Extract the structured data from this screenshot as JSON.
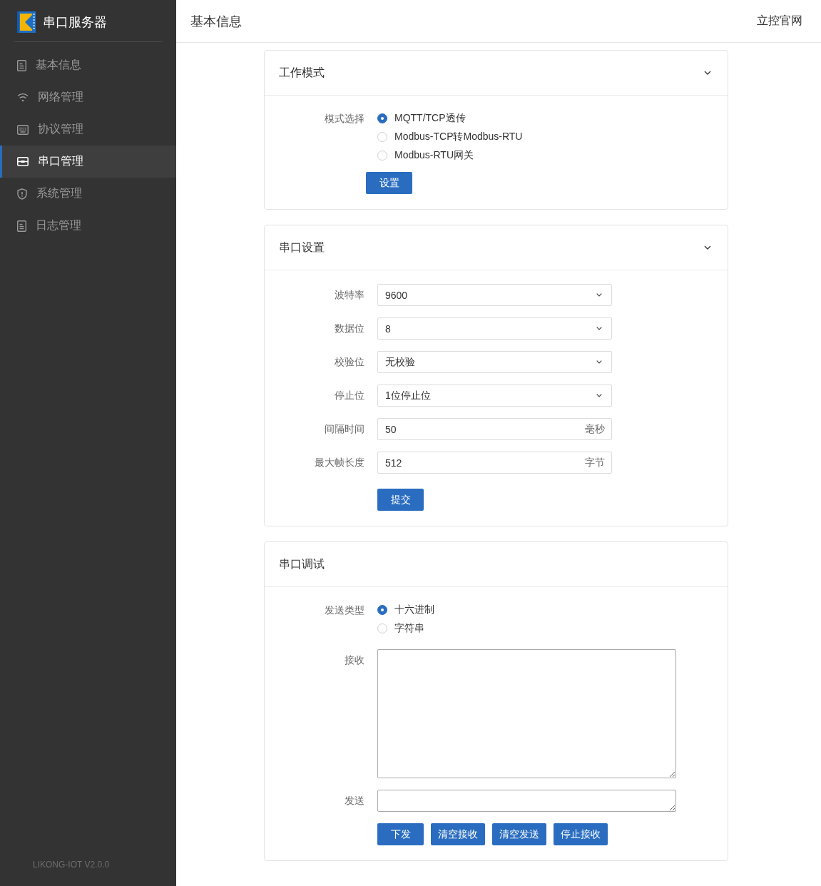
{
  "sidebar": {
    "brand": "串口服务器",
    "items": [
      {
        "label": "基本信息",
        "selected": false
      },
      {
        "label": "网络管理",
        "selected": false
      },
      {
        "label": "协议管理",
        "selected": false
      },
      {
        "label": "串口管理",
        "selected": true
      },
      {
        "label": "系统管理",
        "selected": false
      },
      {
        "label": "日志管理",
        "selected": false
      }
    ],
    "version": "LIKONG-IOT V2.0.0"
  },
  "header": {
    "title": "基本信息",
    "link": "立控官网"
  },
  "cards": [
    {
      "title": "工作模式",
      "expanded": true,
      "fields": [
        {
          "kind": "radio",
          "label": "模式选择",
          "options": [
            {
              "label": "MQTT/TCP透传",
              "selected": true
            },
            {
              "label": "Modbus-TCP转Modbus-RTU",
              "selected": false
            },
            {
              "label": "Modbus-RTU网关",
              "selected": false
            }
          ]
        }
      ],
      "buttons": [
        "设置"
      ]
    },
    {
      "title": "串口设置",
      "expanded": true,
      "fields": [
        {
          "kind": "select",
          "label": "波特率",
          "value": "9600"
        },
        {
          "kind": "select",
          "label": "数据位",
          "value": "8"
        },
        {
          "kind": "select",
          "label": "校验位",
          "value": "无校验"
        },
        {
          "kind": "select",
          "label": "停止位",
          "value": "1位停止位"
        },
        {
          "kind": "input",
          "label": "间隔时间",
          "value": "50",
          "unit": "毫秒"
        },
        {
          "kind": "input",
          "label": "最大帧长度",
          "value": "512",
          "unit": "字节"
        }
      ],
      "buttons": [
        "提交"
      ]
    },
    {
      "title": "串口调试",
      "fields": [
        {
          "kind": "radio",
          "label": "发送类型",
          "options": [
            {
              "label": "十六进制",
              "selected": true
            },
            {
              "label": "字符串",
              "selected": false
            }
          ]
        },
        {
          "kind": "log",
          "label": "接收"
        },
        {
          "kind": "textarea",
          "label": "发送"
        }
      ],
      "buttons": [
        "下发",
        "清空接收",
        "清空发送",
        "停止接收"
      ]
    }
  ]
}
